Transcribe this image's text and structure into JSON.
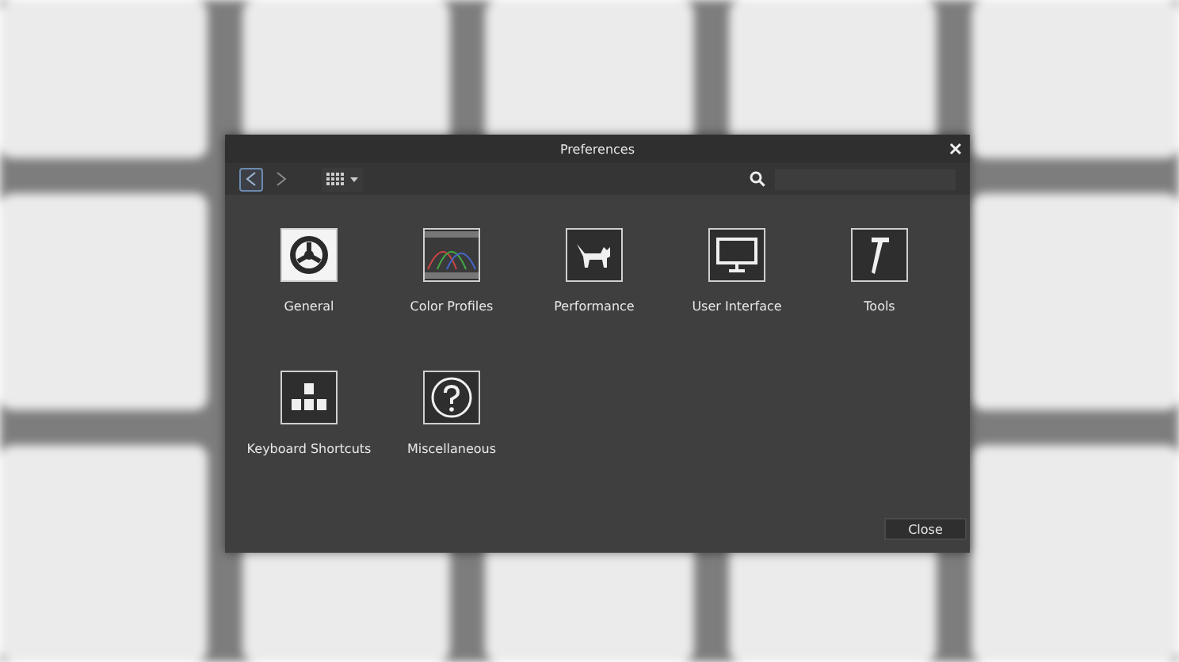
{
  "window": {
    "title": "Preferences"
  },
  "toolbar": {
    "back_disabled": false,
    "forward_disabled": true
  },
  "categories": [
    {
      "label": "General",
      "kind": "gear",
      "selected": true
    },
    {
      "label": "Color Profiles",
      "kind": "profile",
      "selected": false
    },
    {
      "label": "Performance",
      "kind": "cat",
      "selected": false
    },
    {
      "label": "User Interface",
      "kind": "monitor",
      "selected": false
    },
    {
      "label": "Tools",
      "kind": "hammer",
      "selected": false
    },
    {
      "label": "Keyboard Shortcuts",
      "kind": "keys",
      "selected": false
    },
    {
      "label": "Miscellaneous",
      "kind": "question",
      "selected": false
    }
  ],
  "buttons": [
    {
      "label": "Close"
    }
  ]
}
